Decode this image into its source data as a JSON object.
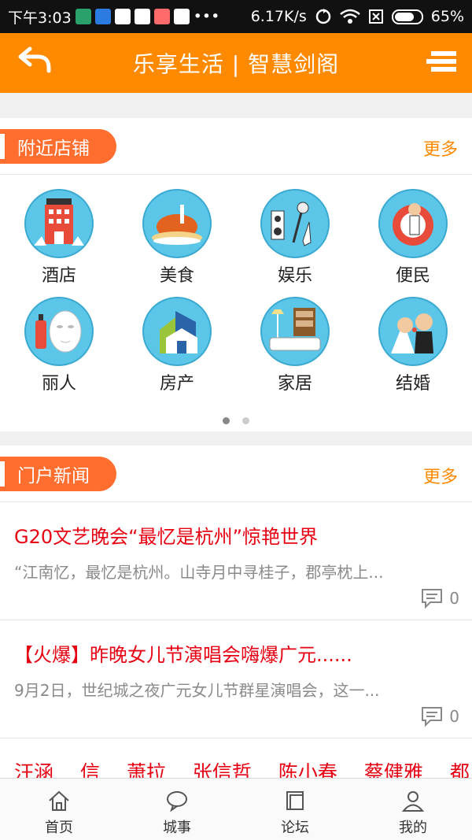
{
  "status_bar": {
    "time": "下午3:03",
    "network_speed": "6.17K/s",
    "battery": "65%",
    "notification_icons": [
      "sim-icon",
      "app-icon",
      "play-icon",
      "play-icon",
      "app-icon",
      "play-icon",
      "more-icon"
    ]
  },
  "header": {
    "title": "乐享生活 | 智慧剑阁",
    "background_color": "#ff8a00"
  },
  "nearby": {
    "tab_label": "附近店铺",
    "more_label": "更多",
    "items": [
      {
        "label": "酒店",
        "icon": "hotel-icon"
      },
      {
        "label": "美食",
        "icon": "food-icon"
      },
      {
        "label": "娱乐",
        "icon": "entertainment-icon"
      },
      {
        "label": "便民",
        "icon": "convenience-icon"
      },
      {
        "label": "丽人",
        "icon": "beauty-icon"
      },
      {
        "label": "房产",
        "icon": "real-estate-icon"
      },
      {
        "label": "家居",
        "icon": "home-furnishing-icon"
      },
      {
        "label": "结婚",
        "icon": "wedding-icon"
      }
    ],
    "pager": {
      "pages": 2,
      "active": 1
    }
  },
  "news": {
    "tab_label": "门户新闻",
    "more_label": "更多",
    "items": [
      {
        "title": "G20文艺晚会“最忆是杭州”惊艳世界",
        "summary": "“江南忆，最忆是杭州。山寺月中寻桂子，郡亭枕上...",
        "comments": "0"
      },
      {
        "title": "【火爆】昨晚女儿节演唱会嗨爆广元......",
        "summary": "9月2日，世纪城之夜广元女儿节群星演唱会，这一...",
        "comments": "0"
      }
    ],
    "ticker": [
      "汪涵",
      "信",
      "萧拉",
      "张信哲",
      "陈小春",
      "蔡健雅",
      "都"
    ]
  },
  "bottom_nav": [
    {
      "label": "首页",
      "icon": "home-icon"
    },
    {
      "label": "城事",
      "icon": "chat-bubble-icon"
    },
    {
      "label": "论坛",
      "icon": "forum-icon"
    },
    {
      "label": "我的",
      "icon": "user-icon"
    }
  ],
  "colors": {
    "accent": "#ff8a00",
    "tab": "#ff6e2e",
    "news_title": "#e60012",
    "icon_circle": "#5cc6e8"
  }
}
